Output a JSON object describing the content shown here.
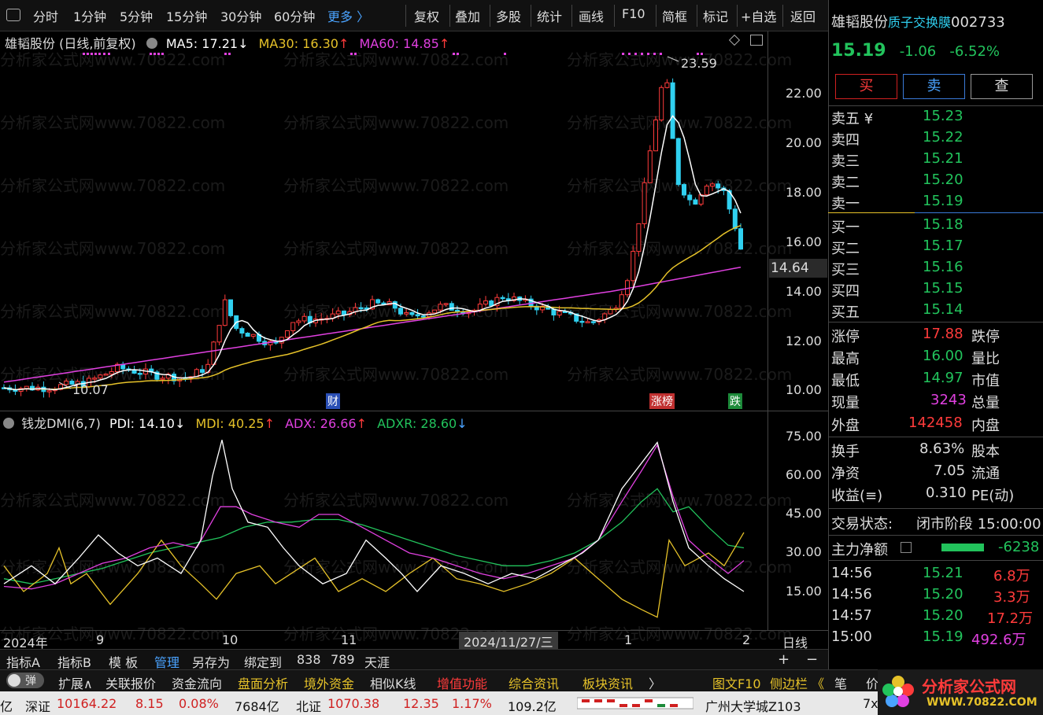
{
  "toolbar": {
    "left": [
      "分时",
      "1分钟",
      "5分钟",
      "15分钟",
      "30分钟",
      "60分钟",
      "更多 〉"
    ],
    "right": [
      "复权",
      "叠加",
      "多股",
      "统计",
      "画线",
      "F10",
      "简框",
      "标记",
      "+自选",
      "返回"
    ]
  },
  "main_chart": {
    "legend_title": "雄韬股份 (日线,前复权)",
    "ma5": "MA5: 17.21",
    "ma30": "MA30: 16.30",
    "ma60": "MA60: 14.85",
    "high_label": "23.59",
    "low_label": "10.07",
    "price_tag": "14.64",
    "y_ticks": [
      "22.00",
      "20.00",
      "18.00",
      "16.00",
      "14.00",
      "12.00",
      "10.00"
    ],
    "markers": {
      "cai": "财",
      "zhangbang": "涨榜",
      "die": "跌"
    },
    "colors": {
      "ma5": "#ffffff",
      "ma30": "#e6c229",
      "ma60": "#e040e0",
      "up": "#ff3b3b",
      "down": "#30d0f0"
    }
  },
  "indicator": {
    "title": "钱龙DMI(6,7)",
    "pdi": "PDI: 14.10",
    "mdi": "MDI: 40.25",
    "adx": "ADX: 26.66",
    "adxr": "ADXR: 28.60",
    "y_ticks": [
      "75.00",
      "60.00",
      "45.00",
      "30.00",
      "15.00"
    ]
  },
  "x_axis": {
    "labels": [
      "2024年",
      "9",
      "10",
      "11",
      "1",
      "2"
    ],
    "cursor_date": "2024/11/27/三",
    "period": "日线"
  },
  "bottom_tabs": [
    "指标A",
    "指标B",
    "模 板",
    "管理",
    "另存为",
    "绑定到",
    "838",
    "789",
    "天涯"
  ],
  "bottom_plus": "+",
  "bottom_minus": "−",
  "nav_bar": [
    "扩展∧",
    "关联报价",
    "资金流向",
    "盘面分析",
    "境外资金",
    "相似K线",
    "增值功能",
    "综合资讯",
    "板块资讯",
    "〉",
    "图文F10",
    "侧边栏 《",
    "笔",
    "价"
  ],
  "toggle_label": "弹",
  "status_bar": {
    "prefix": "亿",
    "sz_label": "深证",
    "sz_value": "10164.22",
    "sz_chg": "8.15",
    "sz_pct": "0.08%",
    "sz_amt": "7684亿",
    "bz_label": "北证",
    "bz_value": "1070.38",
    "bz_chg": "12.35",
    "bz_pct": "1.17%",
    "bz_amt": "109.2亿",
    "ticker": "广州大学城Z103",
    "right_text": "7x"
  },
  "quote": {
    "name": "雄韬股份",
    "concept": "质子交换膜",
    "code": "002733",
    "price": "15.19",
    "change": "-1.06",
    "change_pct": "-6.52%",
    "buttons": {
      "buy": "买",
      "sell": "卖",
      "query": "查"
    },
    "asks": [
      {
        "label": "卖五 ¥",
        "price": "15.23"
      },
      {
        "label": "卖四",
        "price": "15.22"
      },
      {
        "label": "卖三",
        "price": "15.21"
      },
      {
        "label": "卖二",
        "price": "15.20"
      },
      {
        "label": "卖一",
        "price": "15.19"
      }
    ],
    "bids": [
      {
        "label": "买一",
        "price": "15.18"
      },
      {
        "label": "买二",
        "price": "15.17"
      },
      {
        "label": "买三",
        "price": "15.16"
      },
      {
        "label": "买四",
        "price": "15.15"
      },
      {
        "label": "买五",
        "price": "15.14"
      }
    ],
    "stats": [
      {
        "label": "涨停",
        "value": "17.88",
        "color": "red",
        "label2": "跌停"
      },
      {
        "label": "最高",
        "value": "16.00",
        "color": "green",
        "label2": "量比"
      },
      {
        "label": "最低",
        "value": "14.97",
        "color": "green",
        "label2": "市值"
      },
      {
        "label": "现量",
        "value": "3243",
        "color": "magenta",
        "label2": "总量"
      },
      {
        "label": "外盘",
        "value": "142458",
        "color": "red",
        "label2": "内盘"
      }
    ],
    "stats2": [
      {
        "label": "换手",
        "value": "8.63%",
        "label2": "股本"
      },
      {
        "label": "净资",
        "value": "7.05",
        "label2": "流通"
      },
      {
        "label": "收益(≡)",
        "value": "0.310",
        "label2": "PE(动)"
      }
    ],
    "trade_status_label": "交易状态:",
    "trade_status": "闭市阶段 15:00:00",
    "main_flow_label": "主力净额",
    "main_flow_value": "-6238",
    "ticks": [
      {
        "time": "14:56",
        "price": "15.21",
        "vol": "6.8万",
        "color": "red"
      },
      {
        "time": "14:56",
        "price": "15.20",
        "vol": "3.3万",
        "color": "red"
      },
      {
        "time": "14:57",
        "price": "15.20",
        "vol": "17.2万",
        "color": "red"
      },
      {
        "time": "15:00",
        "price": "15.19",
        "vol": "492.6万",
        "color": "magenta"
      }
    ]
  },
  "watermark": "分析家公式网www.70822.com",
  "logo": {
    "title": "分析家公式网",
    "url": "WWW.70822.COM"
  }
}
